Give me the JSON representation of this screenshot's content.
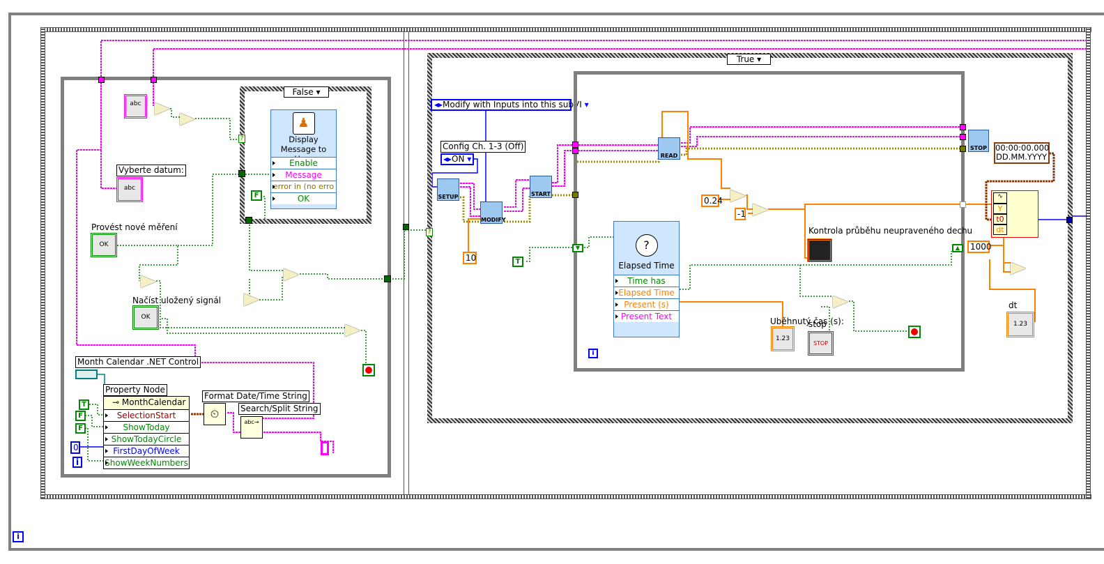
{
  "info_icon": "i",
  "left_frame": {
    "case_selector": "False",
    "display_message": {
      "title": "Display Message to User",
      "terminals": [
        "Enable",
        "Message",
        "error in (no erro",
        "OK"
      ]
    },
    "vyberte_label": "Vyberte datum:",
    "provest_label": "Provést nové měření",
    "nacist_label": "Načíst uložený signál",
    "month_calendar_label": "Month Calendar .NET Control",
    "property_node_label": "Property Node",
    "property_node": {
      "class": "MonthCalendar",
      "properties": [
        "SelectionStart",
        "ShowToday",
        "ShowTodayCircle",
        "FirstDayOfWeek",
        "ShowWeekNumbers"
      ]
    },
    "format_date_label": "Format Date/Time String",
    "search_split_label": "Search/Split String",
    "const_t": "T",
    "const_f1": "F",
    "const_f2": "F",
    "const_zero": "0",
    "const_i": "i",
    "const_f_case": "F",
    "abc": "abc",
    "ok": "OK",
    "info_icon": "i"
  },
  "right_frame": {
    "case_selector": "True",
    "modify_enum": "Modify with Inputs into this subVI",
    "config_label": "Config Ch. 1-3 (Off)",
    "config_value": "ON",
    "const_10": "10",
    "subvis": {
      "setup": "SETUP",
      "modify": "MODIFY",
      "start": "START",
      "read": "READ",
      "stop": "STOP"
    },
    "const_t": "T",
    "elapsed": {
      "title": "Elapsed Time",
      "terminals": [
        "Time has Elapse",
        "Elapsed Time (s)",
        "Present (s)",
        "Present Text"
      ]
    },
    "const_024": "0.24",
    "const_neg1": "-1",
    "graph_label": "Kontrola průběhu neupraveného dechu",
    "elapsed_label": "Uběhnutý čas (s):",
    "elapsed_value": "1.23",
    "stop_label": "stop",
    "stop_btn": "STOP",
    "timestamp": [
      "00:00:00.000",
      "DD.MM.YYYY"
    ],
    "build_wf": [
      "Y",
      "t0",
      "dt"
    ],
    "const_1000": "1000",
    "dt_label": "dt",
    "dt_value": "1.23",
    "info_icon": "i"
  },
  "colors": {
    "string": "#ff00ff",
    "boolean": "#008000",
    "dbl": "#ff8000",
    "integer": "#0000ff",
    "error": "#a09000",
    "timestamp": "#8b3a0e",
    "refnum": "#008080"
  }
}
